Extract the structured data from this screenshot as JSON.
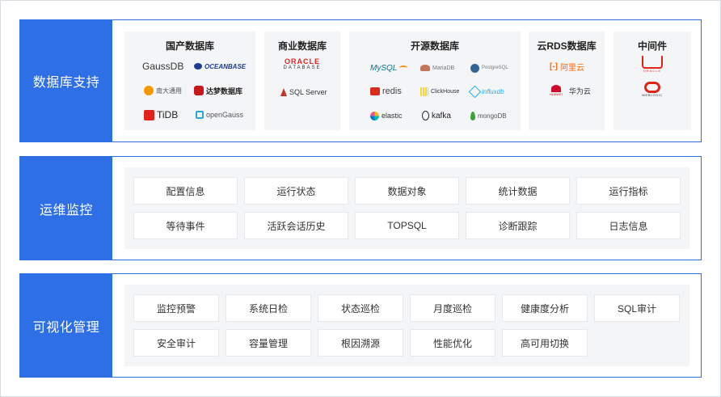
{
  "sections": {
    "db_support": {
      "label": "数据库支持",
      "groups": [
        {
          "title": "国产数据库",
          "logos": [
            "GaussDB",
            "OCEANBASE",
            "南大通用",
            "达梦数据库",
            "TiDB",
            "openGauss"
          ]
        },
        {
          "title": "商业数据库",
          "logos": [
            "ORACLE",
            "DATABASE",
            "SQL Server"
          ]
        },
        {
          "title": "开源数据库",
          "logos": [
            "MySQL",
            "MariaDB",
            "PostgreSQL",
            "redis",
            "ClickHouse",
            "influxdb",
            "elastic",
            "kafka",
            "mongoDB"
          ]
        },
        {
          "title": "云RDS数据库",
          "logos": [
            "阿里云",
            "HUAWEI",
            "华为云"
          ]
        },
        {
          "title": "中间件",
          "logos": [
            "ORACLE",
            "WEBLOGIC"
          ]
        }
      ]
    },
    "ops": {
      "label": "运维监控",
      "items": [
        "配置信息",
        "运行状态",
        "数据对象",
        "统计数据",
        "运行指标",
        "等待事件",
        "活跃会话历史",
        "TOPSQL",
        "诊断跟踪",
        "日志信息"
      ]
    },
    "vis": {
      "label": "可视化管理",
      "items": [
        "监控预警",
        "系统日检",
        "状态巡检",
        "月度巡检",
        "健康度分析",
        "SQL审计",
        "安全审计",
        "容量管理",
        "根因溯源",
        "性能优化",
        "高可用切换"
      ]
    }
  },
  "colors": {
    "accent": "#2f6fe6",
    "panel": "#f4f5f7",
    "oracle_red": "#e2231a",
    "gauss": "#333333",
    "oceanbase": "#1d3c8f",
    "tidb": "#e2231a",
    "redis": "#d82c20",
    "elastic": "#f3bd19",
    "influx": "#22adf6",
    "mongo": "#3fa037",
    "aliyun": "#ff6a00",
    "huawei": "#cf0a2c"
  }
}
